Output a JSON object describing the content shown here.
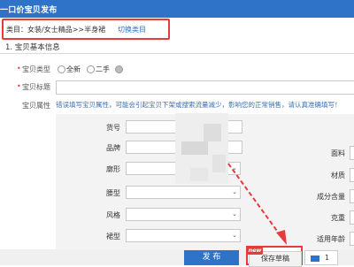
{
  "window": {
    "title": "一口价宝贝发布"
  },
  "category": {
    "label": "类目：女装/女士精品>>半身裙",
    "switch_link": "切换类目"
  },
  "section": {
    "title": "1. 宝贝基本信息"
  },
  "basic": {
    "type_label": "宝贝类型",
    "type_options": [
      "全新",
      "二手"
    ],
    "title_label": "宝贝标题",
    "title_value": "",
    "attr_label": "宝贝属性",
    "attr_notice": "错误填写宝贝属性，可能会引起宝贝下架或搜索流量减少，影响您的正常销售，请认真准确填写！"
  },
  "attributes_left": [
    {
      "label": "货号",
      "kind": "input",
      "value": ""
    },
    {
      "label": "品牌",
      "kind": "input",
      "value": ""
    },
    {
      "label": "廓形",
      "kind": "select",
      "value": ""
    },
    {
      "label": "腰型",
      "kind": "select",
      "value": ""
    },
    {
      "label": "风格",
      "kind": "select",
      "value": ""
    },
    {
      "label": "裙型",
      "kind": "select",
      "value": ""
    }
  ],
  "attributes_right": [
    {
      "label": "面料"
    },
    {
      "label": "材质"
    },
    {
      "label": "成分含量"
    },
    {
      "label": "克重"
    },
    {
      "label": "适用年龄"
    }
  ],
  "footer": {
    "publish_label": "发 布",
    "draft_label": "保存草稿",
    "new_badge": "new",
    "message_count": "1"
  },
  "colors": {
    "accent": "#2f73c9",
    "highlight": "#e53b3b"
  }
}
